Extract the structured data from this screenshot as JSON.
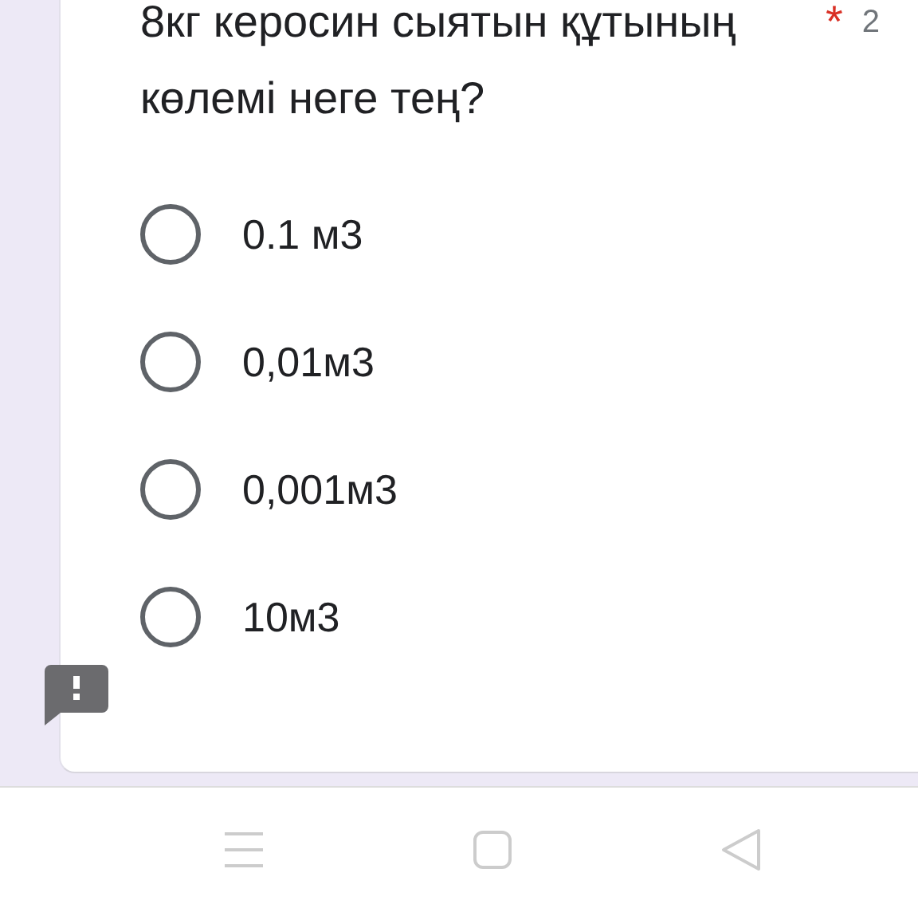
{
  "question": {
    "title": "8кг керосин сыятын құтының көлемі неге тең?",
    "required_mark": "*",
    "points": "2",
    "options": [
      {
        "label": "0.1 м3",
        "selected": false
      },
      {
        "label": "0,01м3",
        "selected": false
      },
      {
        "label": "0,001м3",
        "selected": false
      },
      {
        "label": "10м3",
        "selected": false
      }
    ]
  }
}
